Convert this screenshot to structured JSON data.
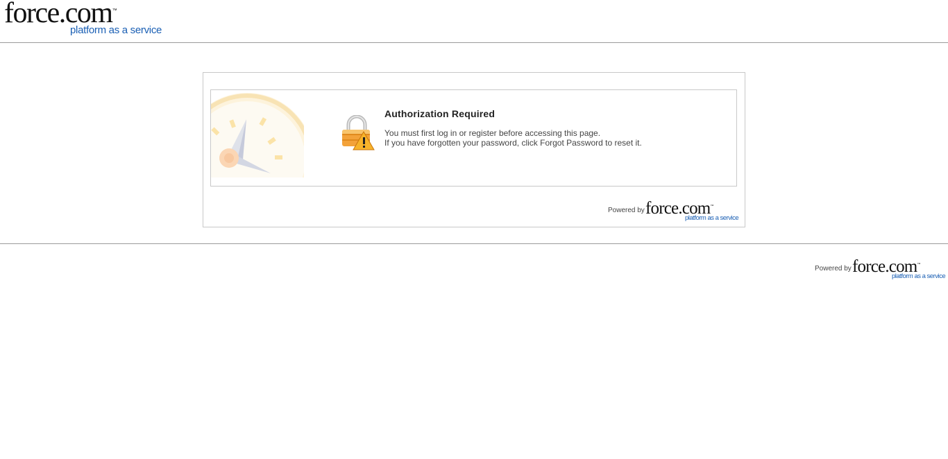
{
  "header": {
    "logo": {
      "wordmark": "force.com",
      "trademark": "™",
      "tagline": "platform as a service"
    }
  },
  "message": {
    "title": "Authorization Required",
    "line1": "You must first log in or register before accessing this page.",
    "line2": "If you have forgotten your password, click Forgot Password to reset it."
  },
  "panel_footer": {
    "powered_by": "Powered by",
    "wordmark": "force.com",
    "trademark": "™",
    "tagline": "platform as a service"
  },
  "page_footer": {
    "powered_by": "Powered by",
    "wordmark": "force.com",
    "trademark": "™",
    "tagline": "platform as a service"
  },
  "icons": {
    "lock": "lock-warning-icon",
    "clock": "clock-watermark-icon"
  },
  "colors": {
    "tagline_blue": "#1a5fb4",
    "divider": "#9a9a9a",
    "panel_border": "#c8c8c8",
    "warning_orange": "#f39a1e"
  }
}
